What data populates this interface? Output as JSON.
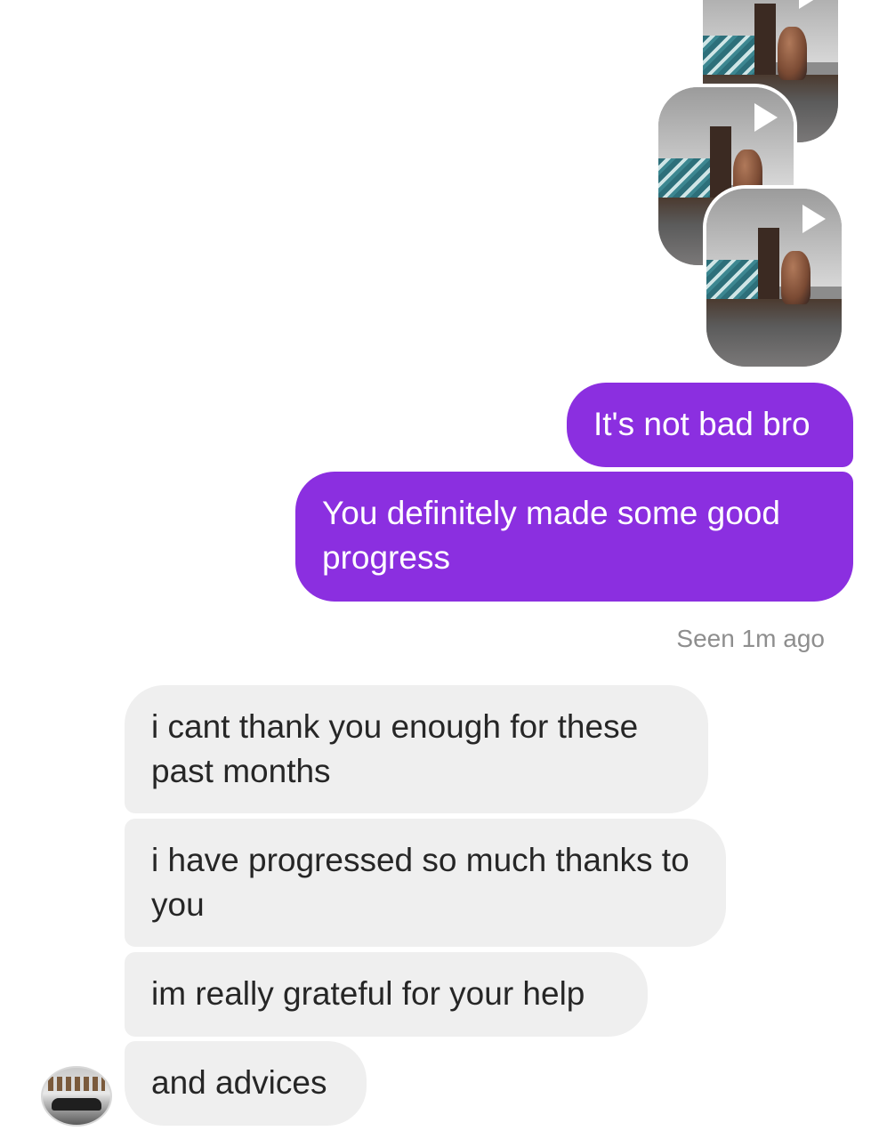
{
  "media": {
    "videos": [
      {
        "icon": "play-icon"
      },
      {
        "icon": "play-icon"
      },
      {
        "icon": "play-icon"
      }
    ]
  },
  "messages": {
    "sent": [
      {
        "text": "It's not bad bro"
      },
      {
        "text": "You definitely made some good progress"
      }
    ],
    "seen_status": "Seen 1m ago",
    "received": [
      {
        "text": "i cant thank you enough for these past months"
      },
      {
        "text": "i have progressed so much thanks to you"
      },
      {
        "text": "im really grateful for your help"
      },
      {
        "text": "and advices"
      }
    ]
  },
  "colors": {
    "sent_bubble": "#8b2fe0",
    "received_bubble": "#efefef",
    "seen_text": "#8e8e8e"
  }
}
